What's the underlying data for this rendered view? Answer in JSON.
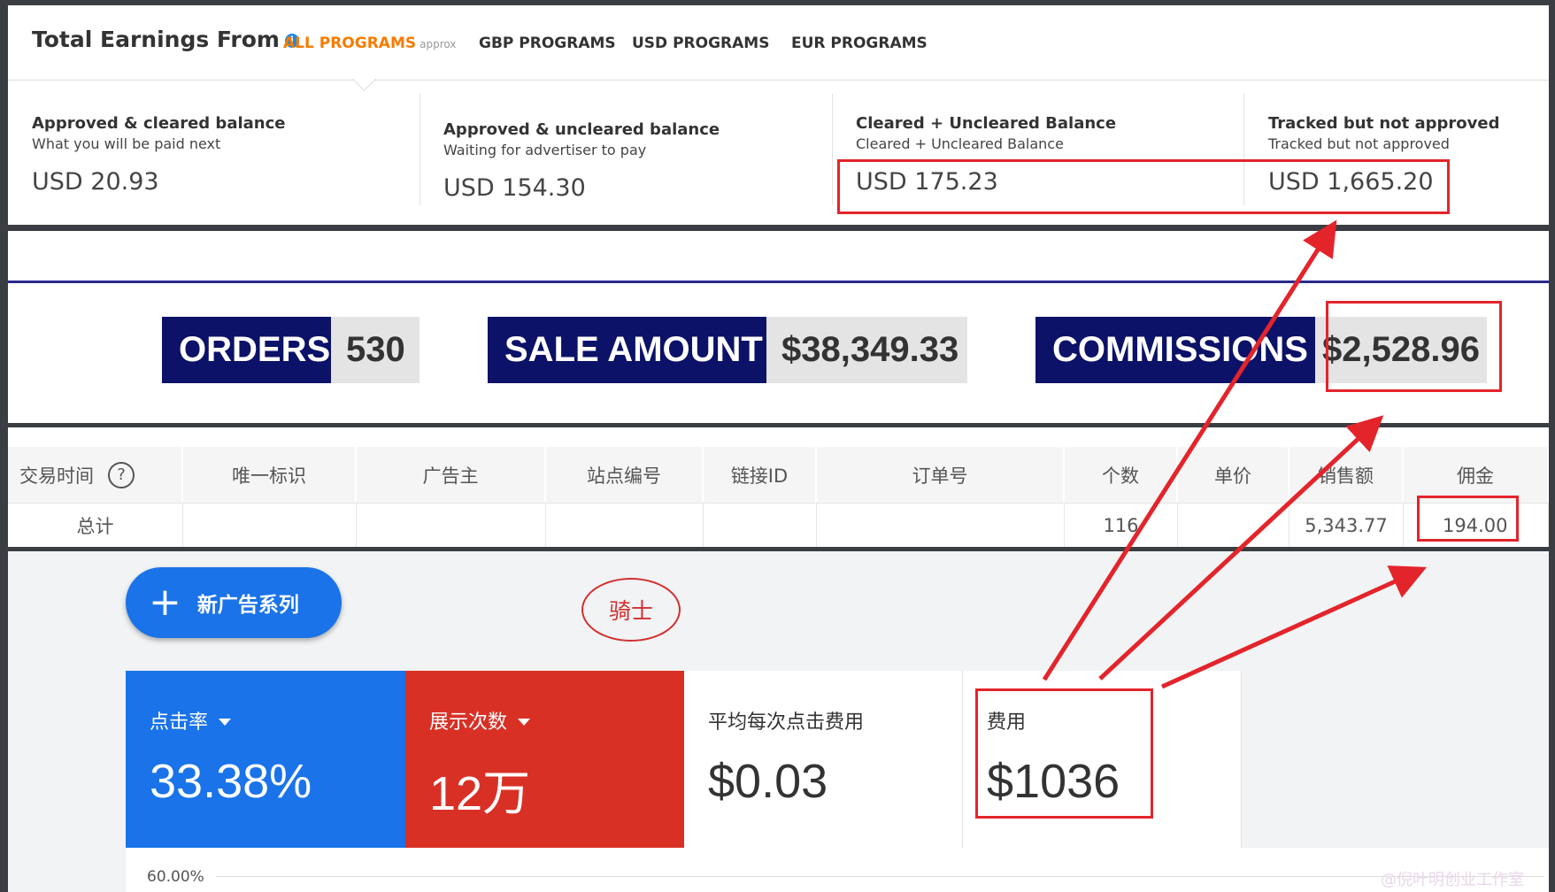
{
  "earnings": {
    "title": "Total Earnings From",
    "tabs": [
      {
        "label": "ALL PROGRAMS",
        "note": "approx"
      },
      {
        "label": "GBP PROGRAMS"
      },
      {
        "label": "USD PROGRAMS"
      },
      {
        "label": "EUR PROGRAMS"
      }
    ],
    "balances": [
      {
        "title": "Approved & cleared balance",
        "subtitle": "What you will be paid next",
        "value": "USD 20.93"
      },
      {
        "title": "Approved & uncleared balance",
        "subtitle": "Waiting for advertiser to pay",
        "value": "USD 154.30"
      },
      {
        "title": "Cleared + Uncleared Balance",
        "subtitle": "Cleared + Uncleared Balance",
        "value": "USD 175.23"
      },
      {
        "title": "Tracked but not approved",
        "subtitle": "Tracked but not approved",
        "value": "USD 1,665.20"
      }
    ]
  },
  "stats": {
    "orders_label": "ORDERS",
    "orders_value": "530",
    "sale_label": "SALE AMOUNT",
    "sale_value": "$38,349.33",
    "commissions_label": "COMMISSIONS",
    "commissions_value": "$2,528.96"
  },
  "table": {
    "headers": [
      "交易时间",
      "唯一标识",
      "广告主",
      "站点编号",
      "链接ID",
      "订单号",
      "个数",
      "单价",
      "销售额",
      "佣金"
    ],
    "help_icon": "?",
    "total_row": {
      "label": "总计",
      "count": "116",
      "sales": "5,343.77",
      "commission": "194.00"
    }
  },
  "ads": {
    "new_campaign_label": "新广告系列",
    "annotation": "骑士",
    "cards": [
      {
        "label": "点击率",
        "value": "33.38%"
      },
      {
        "label": "展示次数",
        "value": "12万"
      },
      {
        "label": "平均每次点击费用",
        "value": "$0.03"
      },
      {
        "label": "费用",
        "value": "$1036"
      }
    ],
    "axis_tick": "60.00%"
  },
  "watermark": "@倪叶明创业工作室",
  "colors": {
    "accent_orange": "#f57c00",
    "navy": "#0c1267",
    "blue": "#1a73e8",
    "red": "#d93025",
    "highlight": "#e3242b"
  }
}
